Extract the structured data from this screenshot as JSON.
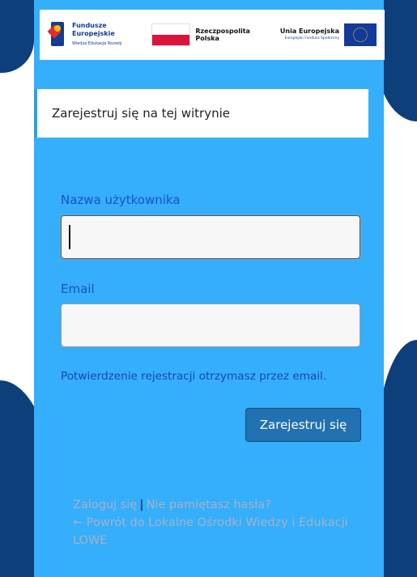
{
  "logos": {
    "fe": {
      "line1": "Fundusze",
      "line2": "Europejskie",
      "line3": "Wiedza Edukacja Rozwój"
    },
    "rp": {
      "line1": "Rzeczpospolita",
      "line2": "Polska"
    },
    "ue": {
      "line1": "Unia Europejska",
      "line2": "Europejski Fundusz Społeczny"
    }
  },
  "message": "Zarejestruj się na tej witrynie",
  "form": {
    "username_label": "Nazwa użytkownika",
    "username_value": "",
    "email_label": "Email",
    "email_value": "",
    "notice": "Potwierdzenie rejestracji otrzymasz przez email.",
    "submit_label": "Zarejestruj się"
  },
  "nav": {
    "login": "Zaloguj się",
    "separator": "|",
    "lost_password": "Nie pamiętasz hasła?",
    "back": "← Powrót do Lokalne Ośrodki Wiedzy i Edukacji LOWE"
  },
  "colors": {
    "panel": "#35aefb",
    "background_shapes": "#0d3f7a",
    "button": "#2271b1",
    "label": "#1c51c4"
  }
}
